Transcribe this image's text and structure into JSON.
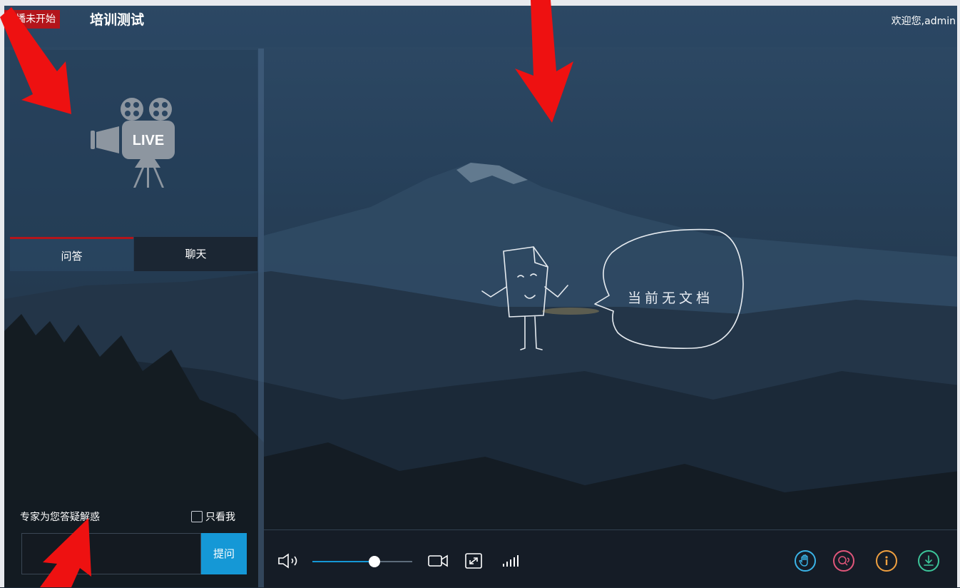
{
  "header": {
    "status": "直播未开始",
    "title": "培训测试",
    "welcome": "欢迎您,admin"
  },
  "live_badge_text": "LIVE",
  "tabs": [
    {
      "label": "问答",
      "active": true
    },
    {
      "label": "聊天",
      "active": false
    }
  ],
  "qa": {
    "hint": "专家为您答疑解惑",
    "only_me_label": "只看我",
    "only_me_checked": false,
    "input_value": "",
    "ask_label": "提问"
  },
  "document": {
    "empty_text": "当前无文档"
  },
  "player": {
    "volume_percent": 62
  },
  "icons": {
    "controls": [
      "volume-icon",
      "camera-icon",
      "screen-icon",
      "signal-icon"
    ],
    "actions": [
      "raise-hand-icon",
      "qa-icon",
      "info-icon",
      "download-icon"
    ]
  },
  "colors": {
    "status_red": "#b3151b",
    "accent_blue": "#1598d6",
    "hand_blue": "#3ab3e6",
    "qa_pink": "#e0567a",
    "info_orange": "#f0a040",
    "download_green": "#3cc59a"
  }
}
